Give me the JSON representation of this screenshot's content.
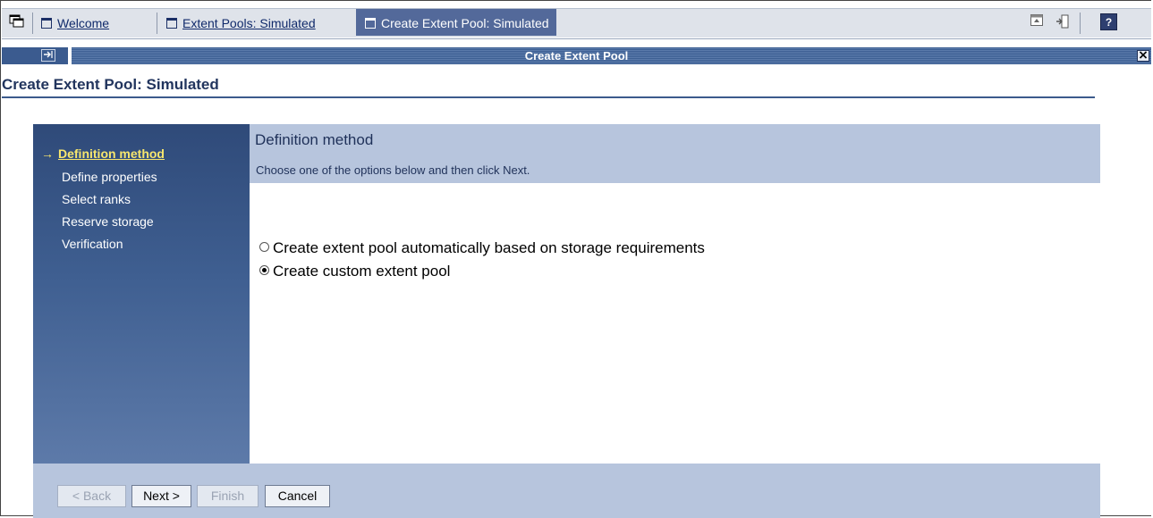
{
  "tabs": [
    {
      "label": "Welcome",
      "active": false
    },
    {
      "label": "Extent Pools: Simulated",
      "active": false
    },
    {
      "label": "Create Extent Pool: Simulated",
      "active": true
    }
  ],
  "titlebar": {
    "title": "Create Extent Pool"
  },
  "page": {
    "title": "Create Extent Pool: Simulated"
  },
  "wizard": {
    "steps": [
      {
        "label": "Definition method",
        "current": true
      },
      {
        "label": "Define properties",
        "current": false
      },
      {
        "label": "Select ranks",
        "current": false
      },
      {
        "label": "Reserve storage",
        "current": false
      },
      {
        "label": "Verification",
        "current": false
      }
    ],
    "step_arrow": "→",
    "heading": "Definition method",
    "instruction": "Choose one of the options below and then click Next.",
    "options": [
      {
        "label": "Create extent pool automatically based on storage requirements",
        "selected": false
      },
      {
        "label": "Create custom extent pool",
        "selected": true
      }
    ],
    "buttons": {
      "back": "< Back",
      "next": "Next >",
      "finish": "Finish",
      "cancel": "Cancel"
    }
  },
  "icons": {
    "tabbar_main": "windows-icon",
    "toolbar": [
      "properties-icon",
      "logout-icon",
      "help-icon"
    ],
    "help_glyph": "?"
  },
  "colors": {
    "nav_dark": "#2f4a79",
    "header_band": "#b7c5dd",
    "current_step": "#f7e66d",
    "active_tab": "#53699a"
  }
}
